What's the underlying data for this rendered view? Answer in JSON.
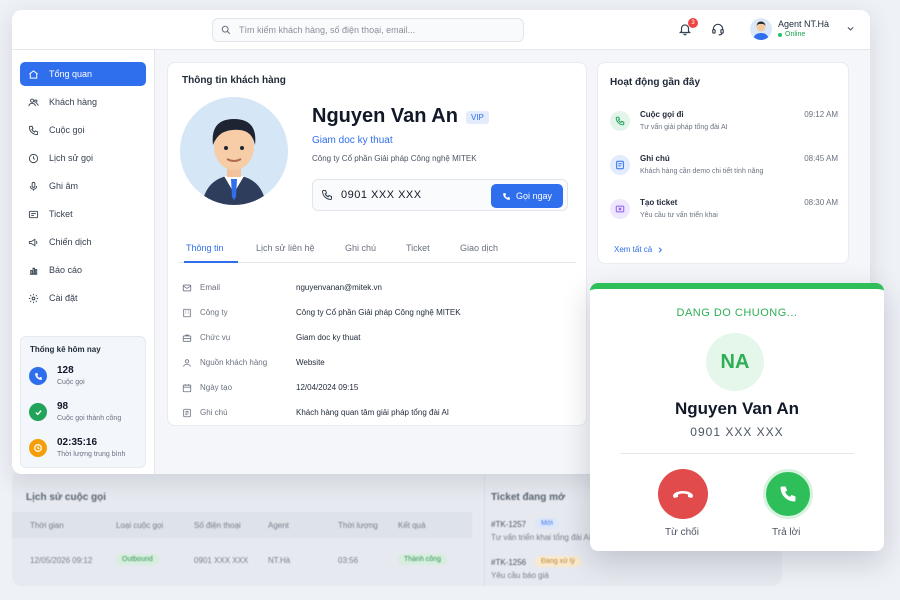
{
  "search": {
    "placeholder": "Tìm kiếm khách hàng, số điện thoại, email..."
  },
  "header": {
    "notification_count": "3",
    "user_name": "Agent NT.Hà",
    "user_status": "Online"
  },
  "sidebar": {
    "items": [
      {
        "label": "Tổng quan",
        "icon": "home-icon"
      },
      {
        "label": "Khách hàng",
        "icon": "users-icon"
      },
      {
        "label": "Cuộc gọi",
        "icon": "phone-icon"
      },
      {
        "label": "Lịch sử gọi",
        "icon": "clock-icon"
      },
      {
        "label": "Ghi âm",
        "icon": "microphone-icon"
      },
      {
        "label": "Ticket",
        "icon": "ticket-icon"
      },
      {
        "label": "Chiến dịch",
        "icon": "megaphone-icon"
      },
      {
        "label": "Báo cáo",
        "icon": "bar-chart-icon"
      },
      {
        "label": "Cài đặt",
        "icon": "gear-icon"
      }
    ],
    "stats": {
      "title": "Thống kê hôm nay",
      "items": [
        {
          "value": "128",
          "label": "Cuộc gọi",
          "color": "#2f6fed"
        },
        {
          "value": "98",
          "label": "Cuộc gọi thành công",
          "color": "#22a35a"
        },
        {
          "value": "02:35:16",
          "label": "Thời lượng trung bình",
          "color": "#f59e0b"
        }
      ]
    }
  },
  "customer": {
    "card_title": "Thông tin khách hàng",
    "name": "Nguyen Van An",
    "badge": "VIP",
    "role": "Giam doc ky thuat",
    "company": "Công ty Cổ phần Giải pháp Công nghệ MITEK",
    "phone": "0901  XXX XXX",
    "call_button": "Gọi ngay",
    "tabs": [
      "Thông tin",
      "Lịch sử liên hệ",
      "Ghi chú",
      "Ticket",
      "Giao dịch"
    ],
    "fields": [
      {
        "key": "Email",
        "value": "nguyenvanan@mitek.vn",
        "icon": "mail-icon"
      },
      {
        "key": "Công ty",
        "value": "Công ty Cổ phần Giải pháp Công nghệ MITEK",
        "icon": "building-icon"
      },
      {
        "key": "Chức vụ",
        "value": "Giam doc ky thuat",
        "icon": "briefcase-icon"
      },
      {
        "key": "Nguồn khách hàng",
        "value": "Website",
        "icon": "user-icon"
      },
      {
        "key": "Ngày tạo",
        "value": "12/04/2024 09:15",
        "icon": "calendar-icon"
      },
      {
        "key": "Ghi chú",
        "value": "Khách hàng quan tâm giải pháp tổng đài AI",
        "icon": "note-icon"
      }
    ]
  },
  "activity": {
    "title": "Hoạt động gần đây",
    "items": [
      {
        "title": "Cuộc gọi đi",
        "subtitle": "Tư vấn giải pháp tổng đài AI",
        "time": "09:12 AM",
        "color": "#22a35a",
        "bg": "#e3f5ea",
        "icon": "phone-outgoing-icon"
      },
      {
        "title": "Ghi chú",
        "subtitle": "Khách hàng cần demo chi tiết tính năng",
        "time": "08:45 AM",
        "color": "#2f6fed",
        "bg": "#e3ecfd",
        "icon": "note-icon"
      },
      {
        "title": "Tạo ticket",
        "subtitle": "Yêu cầu tư vấn triển khai",
        "time": "08:30 AM",
        "color": "#8b5cf6",
        "bg": "#efe8fd",
        "icon": "ticket-icon"
      }
    ],
    "see_all": "Xem tất cả"
  },
  "call_history": {
    "title": "Lịch sử cuộc gọi",
    "columns": [
      "Thời gian",
      "Loại cuộc gọi",
      "Số điện thoại",
      "Agent",
      "Thời lượng",
      "Kết quả"
    ],
    "rows": [
      {
        "time": "12/05/2026 09:12",
        "type": "Outbound",
        "phone": "0901 XXX XXX",
        "agent": "NT.Hà",
        "duration": "03:56",
        "result": "Thành công"
      }
    ]
  },
  "open_tickets": {
    "title": "Ticket đang mở",
    "items": [
      {
        "id": "#TK-1257",
        "status": "Mới",
        "desc": "Tư vấn triển khai tổng đài AI"
      },
      {
        "id": "#TK-1256",
        "status": "Đang xử lý",
        "desc": "Yêu cầu báo giá"
      }
    ]
  },
  "incoming_call": {
    "status": "DANG DO CHUONG...",
    "initials": "NA",
    "name": "Nguyen Van An",
    "phone": "0901 XXX XXX",
    "decline_label": "Từ chối",
    "accept_label": "Trả lời"
  }
}
